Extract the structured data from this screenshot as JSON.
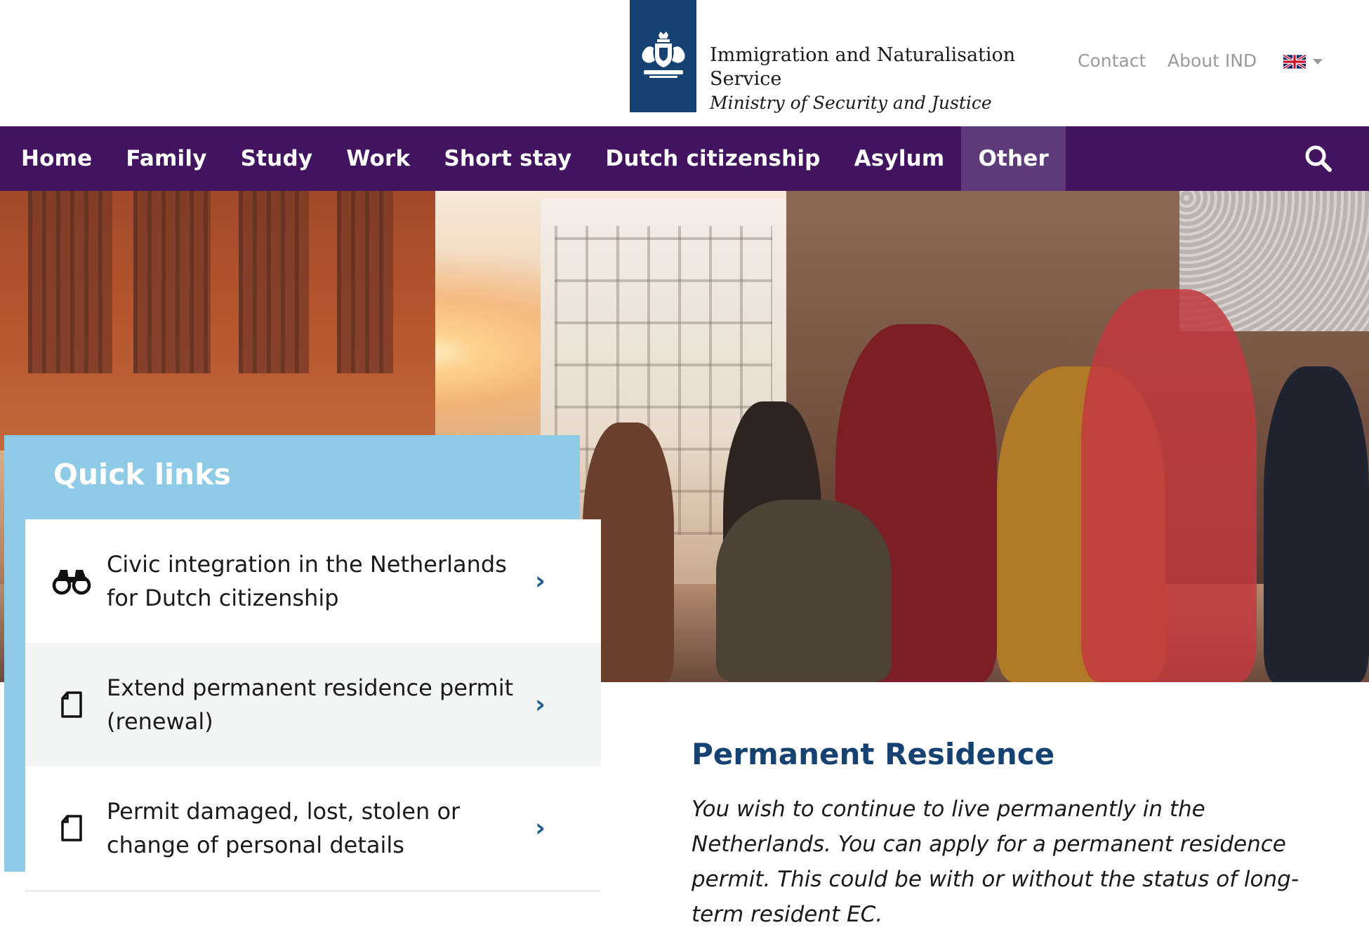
{
  "header": {
    "logo_line1": "Immigration and Naturalisation",
    "logo_line2": "Service",
    "logo_line3": "Ministry of Security and Justice",
    "contact_label": "Contact",
    "about_label": "About IND",
    "language_icon": "uk-flag-icon"
  },
  "nav": {
    "items": [
      {
        "label": "Home"
      },
      {
        "label": "Family"
      },
      {
        "label": "Study"
      },
      {
        "label": "Work"
      },
      {
        "label": "Short stay"
      },
      {
        "label": "Dutch citizenship"
      },
      {
        "label": "Asylum"
      },
      {
        "label": "Other"
      }
    ],
    "active": "Other",
    "search_icon": "search-icon"
  },
  "quick_links": {
    "title": "Quick links",
    "items": [
      {
        "label": "Civic integration in the Netherlands for Dutch citizenship",
        "icon": "binoculars-icon"
      },
      {
        "label": "Extend permanent residence permit (renewal)",
        "icon": "document-icon"
      },
      {
        "label": "Permit damaged, lost, stolen or change of personal details",
        "icon": "document-icon"
      }
    ]
  },
  "main": {
    "title": "Permanent Residence",
    "intro": "You wish to continue to live permanently in the Netherlands. You can apply for a permanent residence permit. This could be with or without the status of long-term resident EC."
  },
  "colors": {
    "nav_bg": "#42145f",
    "nav_active": "#5d3a7a",
    "logo_bg": "#154273",
    "quick_links_bg": "#8fcae7",
    "title_color": "#154273",
    "chevron": "#1f5c99"
  }
}
